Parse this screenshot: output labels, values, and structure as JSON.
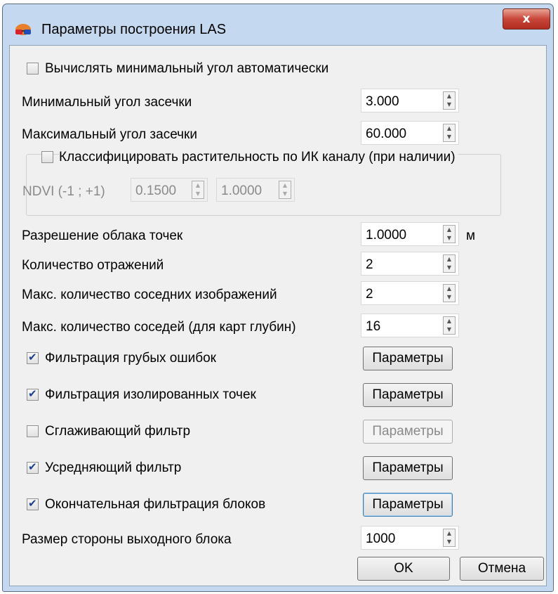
{
  "window": {
    "title": "Параметры построения LAS",
    "close_glyph": "x"
  },
  "auto_angle": {
    "label": "Вычислять минимальный угол автоматически",
    "checked": false
  },
  "min_angle": {
    "label": "Минимальный угол засечки",
    "value": "3.000"
  },
  "max_angle": {
    "label": "Максимальный угол засечки",
    "value": "60.000"
  },
  "vegetation": {
    "label": "Классифицировать растительность по ИК каналу (при наличии)",
    "checked": false,
    "ndvi_label": "NDVI (-1 ; +1)",
    "ndvi_min": "0.1500",
    "ndvi_max": "1.0000"
  },
  "resolution": {
    "label": "Разрешение облака точек",
    "value": "1.0000",
    "unit": "м"
  },
  "reflections": {
    "label": "Количество отражений",
    "value": "2"
  },
  "max_neighbor_images": {
    "label": "Макс. количество соседних изображений",
    "value": "2"
  },
  "max_neighbors_depth": {
    "label": "Макс. количество соседей (для карт глубин)",
    "value": "16"
  },
  "filters": [
    {
      "label": "Фильтрация грубых ошибок",
      "checked": true,
      "button": "Параметры",
      "enabled": true
    },
    {
      "label": "Фильтрация изолированных точек",
      "checked": true,
      "button": "Параметры",
      "enabled": true
    },
    {
      "label": "Сглаживающий фильтр",
      "checked": false,
      "button": "Параметры",
      "enabled": false
    },
    {
      "label": "Усредняющий фильтр",
      "checked": true,
      "button": "Параметры",
      "enabled": true
    },
    {
      "label": "Окончательная фильтрация блоков",
      "checked": true,
      "button": "Параметры",
      "enabled": true
    }
  ],
  "block_size": {
    "label": "Размер стороны выходного блока",
    "value": "1000"
  },
  "buttons": {
    "ok": "OK",
    "cancel": "Отмена"
  },
  "icons": {
    "app": "stereo-glasses-icon",
    "close": "close-icon",
    "spin_up": "spin-up-icon",
    "spin_down": "spin-down-icon",
    "check": "checkmark-icon"
  },
  "colors": {
    "frame": "#c4d9ef",
    "client": "#f0f0f0",
    "close": "#c8463a",
    "check": "#1f3e8c"
  }
}
